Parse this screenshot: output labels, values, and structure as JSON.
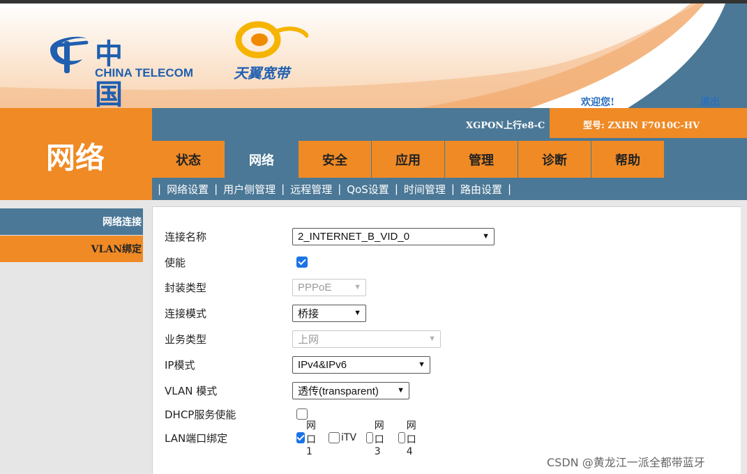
{
  "header": {
    "logo_cn": "中国电信",
    "logo_en": "CHINA TELECOM",
    "brand": "天翼宽带",
    "welcome": "欢迎您!",
    "logout": "退出"
  },
  "page_title": "网络",
  "infobar": {
    "uplink": "XGPON上行e8-C",
    "model": "型号: ZXHN F7010C-HV"
  },
  "tabs": [
    {
      "label": "状态",
      "active": false
    },
    {
      "label": "网络",
      "active": true
    },
    {
      "label": "安全",
      "active": false
    },
    {
      "label": "应用",
      "active": false
    },
    {
      "label": "管理",
      "active": false
    },
    {
      "label": "诊断",
      "active": false
    },
    {
      "label": "帮助",
      "active": false
    }
  ],
  "subtabs": [
    "网络设置",
    "用户侧管理",
    "远程管理",
    "QoS设置",
    "时间管理",
    "路由设置"
  ],
  "sidebar": {
    "items": [
      "网络连接",
      "VLAN绑定"
    ]
  },
  "form": {
    "conn_name": {
      "label": "连接名称",
      "value": "2_INTERNET_B_VID_0"
    },
    "enable": {
      "label": "使能",
      "checked": true
    },
    "encap": {
      "label": "封装类型",
      "value": "PPPoE"
    },
    "conn_mode": {
      "label": "连接模式",
      "value": "桥接"
    },
    "service": {
      "label": "业务类型",
      "value": "上网"
    },
    "ip_mode": {
      "label": "IP模式",
      "value": "IPv4&IPv6"
    },
    "vlan_mode": {
      "label": "VLAN 模式",
      "value": "透传(transparent)"
    },
    "dhcp": {
      "label": "DHCP服务使能",
      "checked": false
    },
    "lan_bind": {
      "label": "LAN端口绑定",
      "ports": [
        {
          "label": "网口1",
          "checked": true
        },
        {
          "label": "iTV",
          "checked": false
        },
        {
          "label": "网口3",
          "checked": false
        },
        {
          "label": "网口4",
          "checked": false
        }
      ]
    }
  },
  "watermark": "CSDN @黄龙江一派全都带蓝牙",
  "colors": {
    "orange": "#ef8a25",
    "steel_blue": "#4b7896",
    "brand_blue": "#1f5fb0"
  }
}
